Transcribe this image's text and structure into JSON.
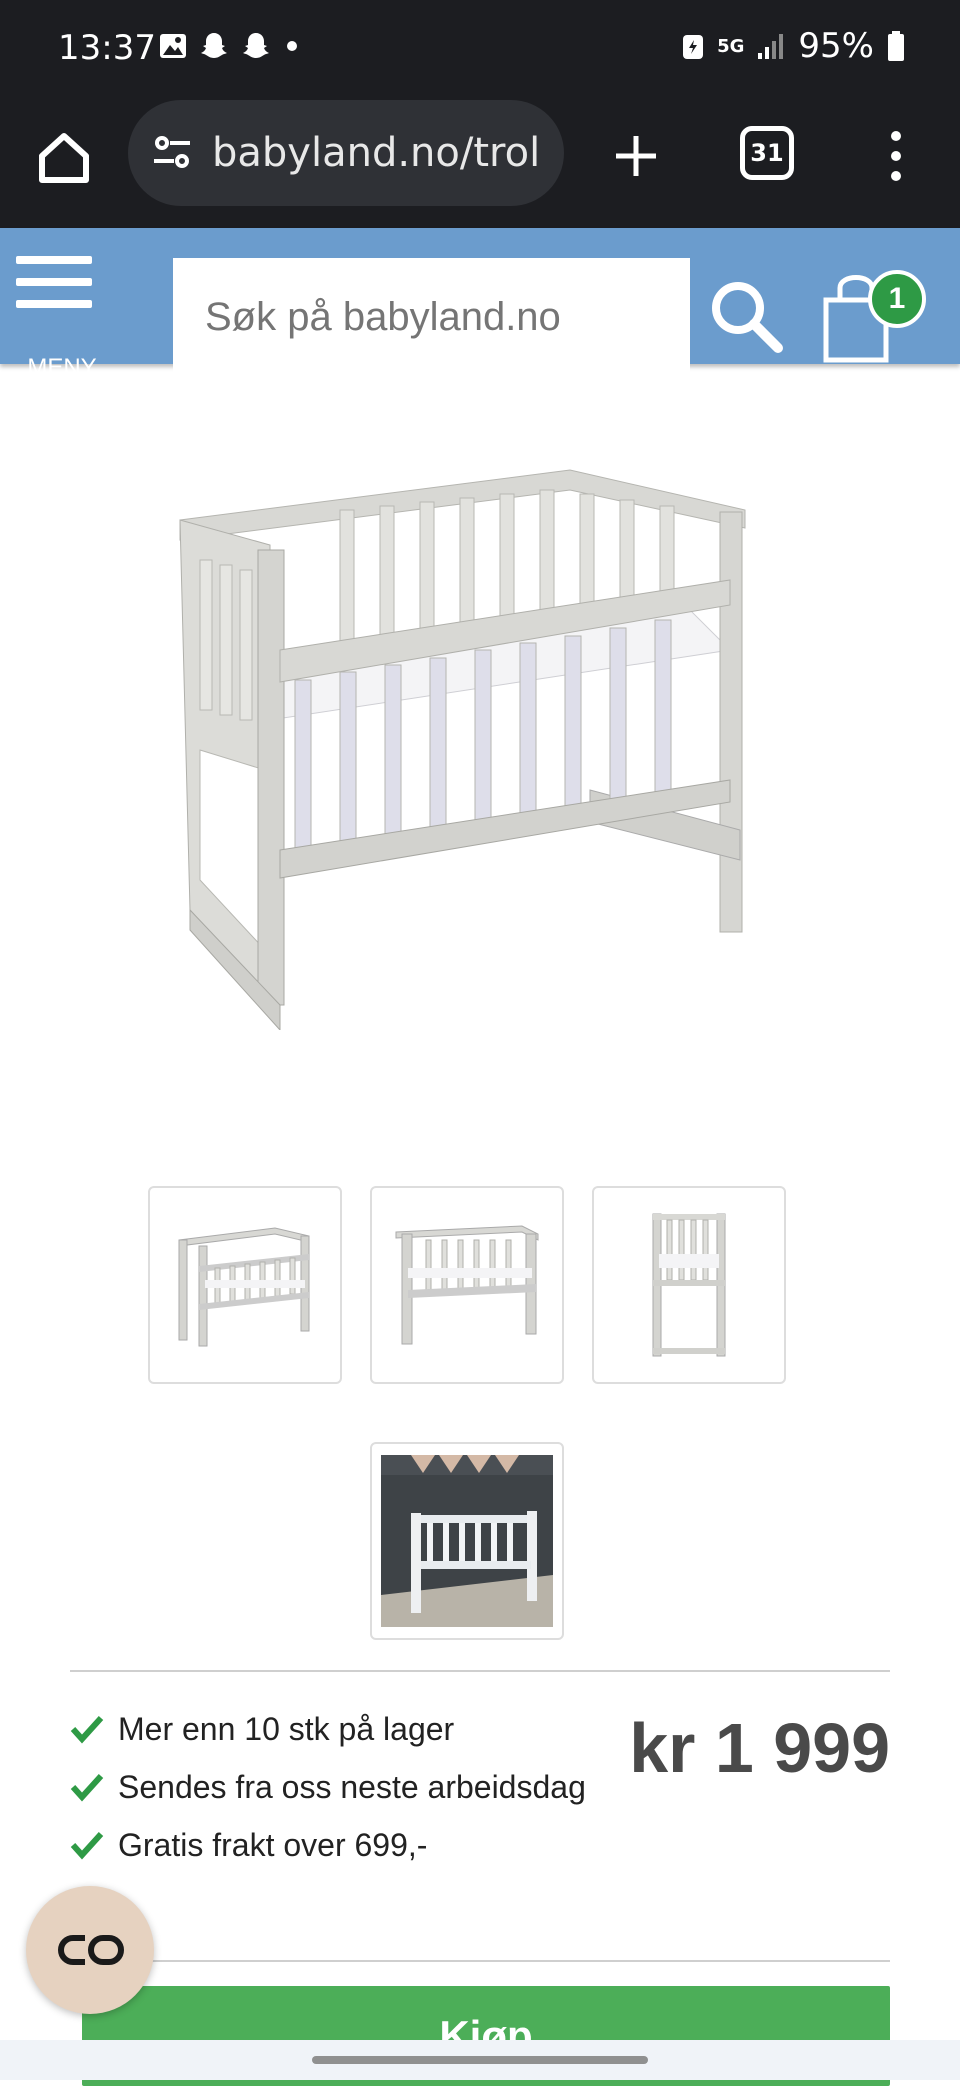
{
  "status_bar": {
    "time": "13:37",
    "network": "5G",
    "battery": "95%"
  },
  "browser": {
    "url": "babyland.no/troll",
    "tab_count": "31"
  },
  "header": {
    "menu_label": "MENY",
    "search_placeholder": "Søk på babyland.no",
    "cart_count": "1",
    "brand_color": "#6b9ccd"
  },
  "product": {
    "thumbnails_count": 4,
    "stock_lines": [
      "Mer enn 10 stk på lager",
      "Sendes fra oss neste arbeidsdag",
      "Gratis frakt over 699,-"
    ],
    "price": "kr 1 999",
    "buy_label": "Kjøp",
    "check_color": "#2e9a45",
    "buy_color": "#4cae58"
  }
}
